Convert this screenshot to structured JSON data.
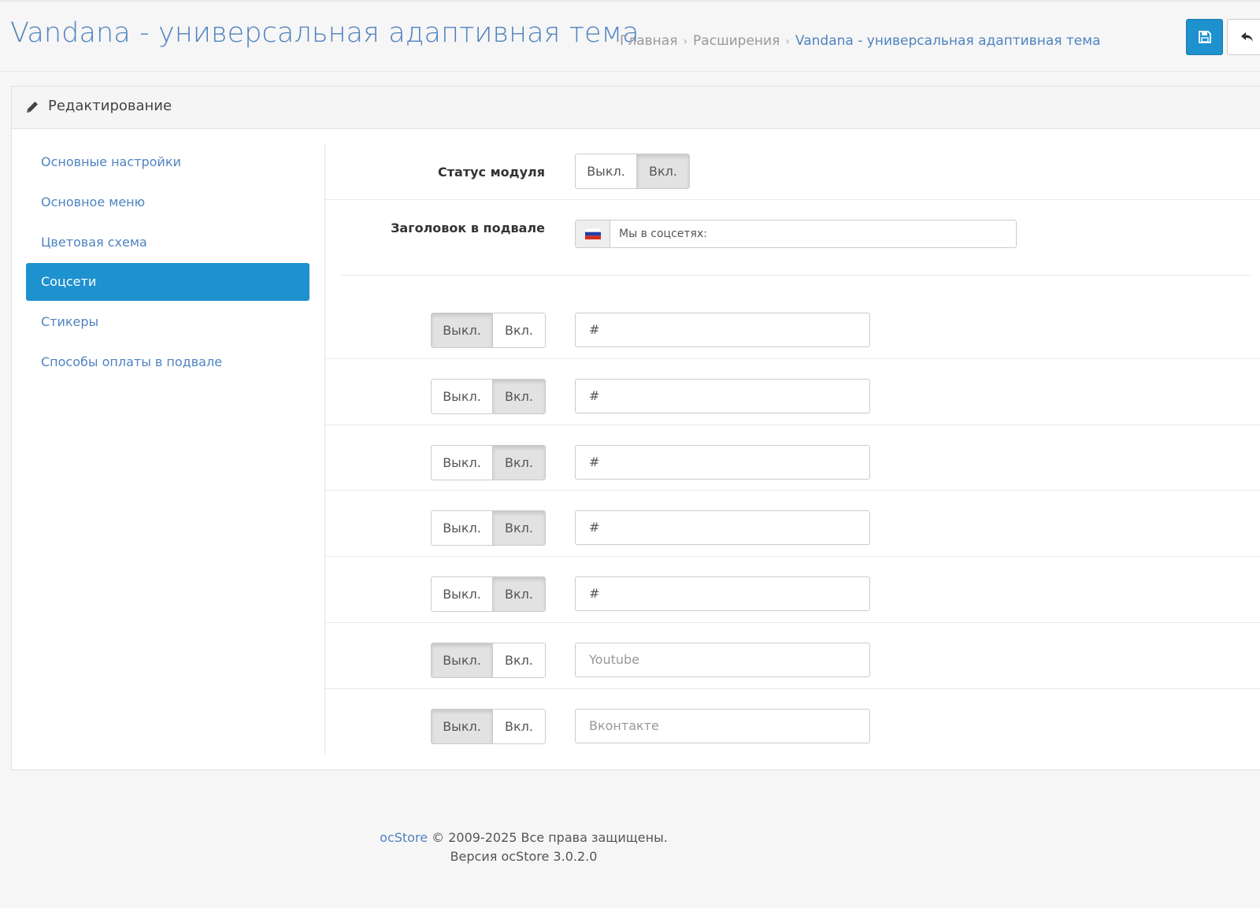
{
  "header": {
    "title": "Vandana - универсальная адаптивная тема",
    "breadcrumbs": [
      {
        "label": "Главная"
      },
      {
        "label": "Расширения"
      },
      {
        "label": "Vandana - универсальная адаптивная тема"
      }
    ],
    "colors": {
      "primary": "#1e91cf",
      "title": "#4f83c0"
    }
  },
  "panel": {
    "heading": "Редактирование"
  },
  "sidebar": {
    "items": [
      {
        "label": "Основные настройки",
        "active": false
      },
      {
        "label": "Основное меню",
        "active": false
      },
      {
        "label": "Цветовая схема",
        "active": false
      },
      {
        "label": "Соцсети",
        "active": true
      },
      {
        "label": "Стикеры",
        "active": false
      },
      {
        "label": "Способы оплаты в подвале",
        "active": false
      }
    ]
  },
  "form": {
    "module_status": {
      "label": "Статус модуля",
      "off": "Выкл.",
      "on": "Вкл.",
      "selected": "on"
    },
    "footer_title": {
      "label": "Заголовок в подвале",
      "flag": "ru-flag-icon",
      "value": "Мы в соцсетях:"
    },
    "social_rows": [
      {
        "selected": "off",
        "off": "Выкл.",
        "on": "Вкл.",
        "value": "#",
        "placeholder": ""
      },
      {
        "selected": "on",
        "off": "Выкл.",
        "on": "Вкл.",
        "value": "#",
        "placeholder": ""
      },
      {
        "selected": "on",
        "off": "Выкл.",
        "on": "Вкл.",
        "value": "#",
        "placeholder": ""
      },
      {
        "selected": "on",
        "off": "Выкл.",
        "on": "Вкл.",
        "value": "#",
        "placeholder": ""
      },
      {
        "selected": "on",
        "off": "Выкл.",
        "on": "Вкл.",
        "value": "#",
        "placeholder": ""
      },
      {
        "selected": "off",
        "off": "Выкл.",
        "on": "Вкл.",
        "value": "",
        "placeholder": "Youtube"
      },
      {
        "selected": "off",
        "off": "Выкл.",
        "on": "Вкл.",
        "value": "",
        "placeholder": "Вконтакте"
      }
    ]
  },
  "footer": {
    "brand": "ocStore",
    "copyright": "© 2009-2025 Все права защищены.",
    "version": "Версия ocStore 3.0.2.0"
  }
}
